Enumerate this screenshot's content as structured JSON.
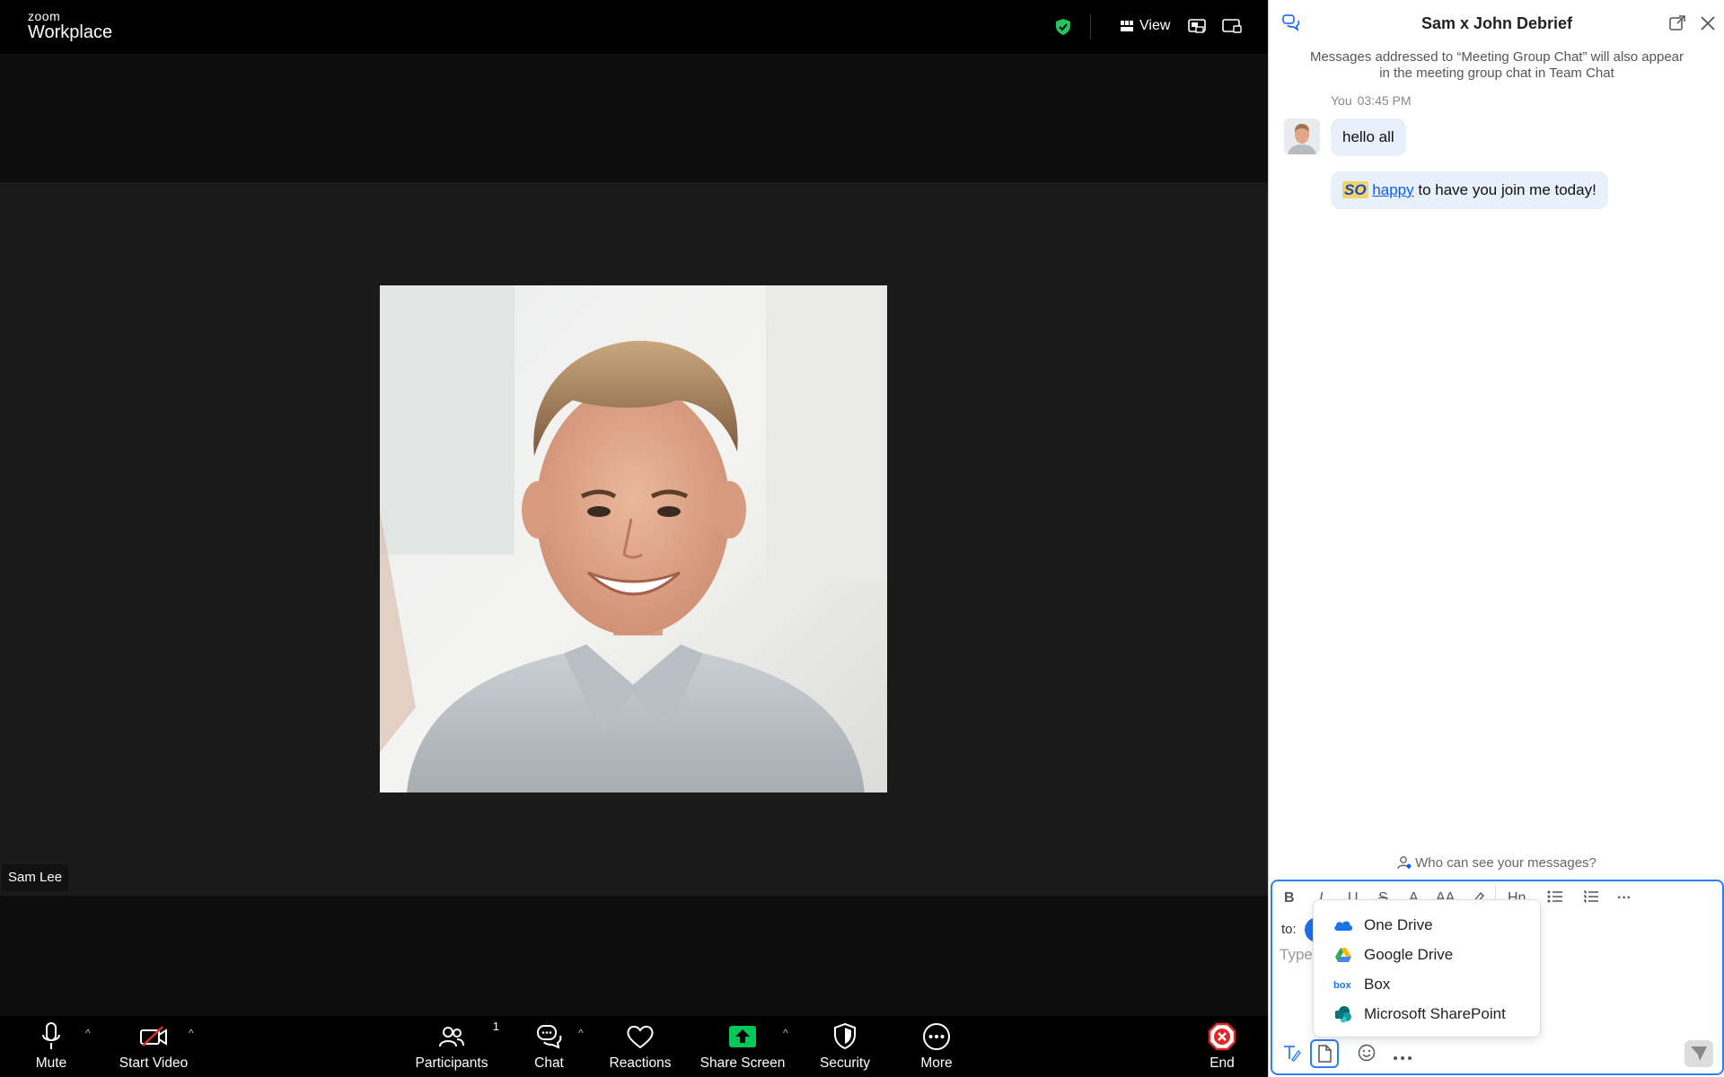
{
  "app": {
    "logo_top": "zoom",
    "logo_bottom": "Workplace"
  },
  "topbar": {
    "view_label": "View"
  },
  "stage": {
    "participant_name": "Sam Lee"
  },
  "toolbar": {
    "mute_label": "Mute",
    "video_label": "Start Video",
    "participants_label": "Participants",
    "participants_count": "1",
    "chat_label": "Chat",
    "reactions_label": "Reactions",
    "share_label": "Share Screen",
    "security_label": "Security",
    "more_label": "More",
    "end_label": "End"
  },
  "chat": {
    "title": "Sam x John Debrief",
    "notice": "Messages addressed to “Meeting Group Chat” will also appear in the meeting group chat in Team Chat",
    "sender": "You",
    "time": "03:45 PM",
    "messages": [
      {
        "text": "hello all"
      },
      {
        "emphasis": "SO",
        "link": "happy",
        "rest": " to have you join me today!"
      }
    ],
    "visibility_prompt": "Who can see your messages?",
    "to_label": "to:",
    "placeholder": "Type",
    "format": {
      "bold": "B",
      "italic": "I",
      "underline": "U",
      "strike": "S",
      "font_color": "A",
      "font_size": "AA",
      "heading": "Hn",
      "more": "···"
    },
    "file_menu": [
      {
        "label": "One Drive",
        "icon": "onedrive-icon"
      },
      {
        "label": "Google Drive",
        "icon": "google-drive-icon"
      },
      {
        "label": "Box",
        "icon": "box-icon"
      },
      {
        "label": "Microsoft SharePoint",
        "icon": "sharepoint-icon"
      }
    ]
  },
  "colors": {
    "accent": "#0b5cff",
    "share_green": "#00c95a",
    "end_red": "#e02828",
    "security_green": "#22c55e"
  }
}
